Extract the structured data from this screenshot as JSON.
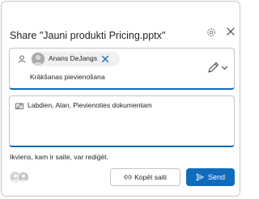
{
  "dialog": {
    "title": "Share \"Jauni produkti Pricing.pptx\"",
    "icons": {
      "settings": "gear-icon",
      "close": "close-icon"
    }
  },
  "recipients": {
    "chip_name": "Anans DeJangs",
    "subtitle": "Krākšanas pievienošana"
  },
  "message": {
    "text": "Labdien,  Alan,  Pievienoties dokumentam"
  },
  "footer": {
    "access_note": "Ikviens, kam ir saite, var rediģēt.",
    "copy_label": "Kopēt saiti",
    "send_label": "Send"
  },
  "colors": {
    "accent": "#0f6cbd",
    "border": "#c4c4c4",
    "chip_bg": "#f0f0f0"
  }
}
